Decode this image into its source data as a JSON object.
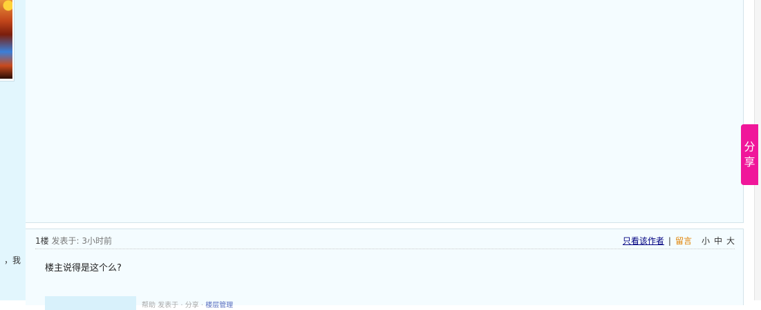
{
  "left": {
    "snippet": "，我"
  },
  "reply": {
    "floor": "1楼",
    "posted_label": "发表于:",
    "time": "3小时前",
    "only_author": "只看该作者",
    "separator": "|",
    "comment": "留言",
    "font_sizes": [
      "小",
      "中",
      "大"
    ],
    "text": "楼主说得是这个么?",
    "faint_meta": "帮助 发表于 · 分享 · ",
    "faint_link": "楼层管理"
  },
  "share": {
    "chars": [
      "分",
      "享"
    ]
  },
  "colors": {
    "share_tab": "#f0179a",
    "only_author_link": "#000080",
    "comment_link": "#e08000",
    "panel_bg": "#f4fcff",
    "left_col_bg": "#e2f6fd"
  },
  "icons": [
    "avatar-image"
  ]
}
